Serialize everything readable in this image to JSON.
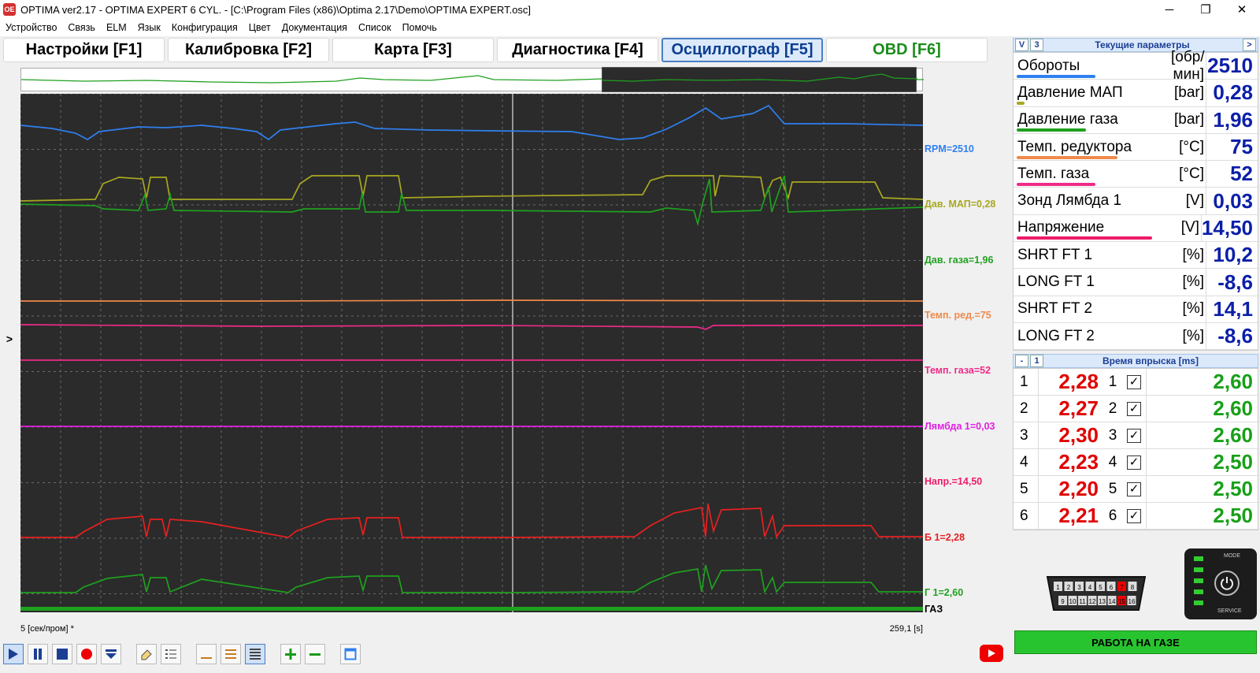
{
  "window": {
    "title": "OPTIMA ver2.17 - OPTIMA EXPERT 6 CYL. - [C:\\Program Files (x86)\\Optima 2.17\\Demo\\OPTIMA EXPERT.osc]",
    "icon_label": "OE",
    "minimize": "─",
    "maximize": "❐",
    "close": "✕"
  },
  "menu": [
    "Устройство",
    "Связь",
    "ELM",
    "Язык",
    "Конфигурация",
    "Цвет",
    "Документация",
    "Список",
    "Помочь"
  ],
  "tabs": [
    {
      "label": "Настройки [F1]",
      "active": false
    },
    {
      "label": "Калибровка [F2]",
      "active": false
    },
    {
      "label": "Карта [F3]",
      "active": false
    },
    {
      "label": "Диагностика [F4]",
      "active": false
    },
    {
      "label": "Осциллограф [F5]",
      "active": true
    },
    {
      "label": "OBD [F6]",
      "active": false
    }
  ],
  "side_toggle": ">",
  "scope": {
    "cursor_fraction": 0.545,
    "labels": [
      {
        "text": "RPM=2510",
        "color": "#2f80f0"
      },
      {
        "text": "Дав. МАП=0,28",
        "color": "#a8a822"
      },
      {
        "text": "Дав. газа=1,96",
        "color": "#1fa01f"
      },
      {
        "text": "Темп. ред.=75",
        "color": "#f08a4a"
      },
      {
        "text": "Темп. газа=52",
        "color": "#ee2b88"
      },
      {
        "text": "Лямбда 1=0,03",
        "color": "#e020e0"
      },
      {
        "text": "Напр.=14,50",
        "color": "#ee1c6a"
      },
      {
        "text": "Б 1=2,28",
        "color": "#e82020"
      },
      {
        "text": "Г 1=2,60",
        "color": "#1fa01f"
      },
      {
        "text": "ГАЗ",
        "color": "#000000"
      }
    ],
    "time_scale": "5 [сек/пром] *",
    "time_pos": "259,1 [s]"
  },
  "toolbar": [
    "play-icon",
    "pause-icon",
    "stop-icon",
    "record-icon",
    "download-icon",
    "eraser-icon",
    "list-icon",
    "single-line-icon",
    "multi-line-icon",
    "grid-line-icon",
    "zoom-in-icon",
    "zoom-out-icon",
    "window-icon"
  ],
  "params_panel": {
    "btn_v": "V",
    "btn_3": "3",
    "title": "Текущие параметры",
    "btn_next": ">",
    "rows": [
      {
        "name": "Обороты",
        "unit": "[обр/мин]",
        "value": "2510",
        "underline": "#2f80f0",
        "uw": 100
      },
      {
        "name": "Давление МАП",
        "unit": "[bar]",
        "value": "0,28",
        "underline": "#a8a822",
        "uw": 10
      },
      {
        "name": "Давление газа",
        "unit": "[bar]",
        "value": "1,96",
        "underline": "#1fa01f",
        "uw": 88
      },
      {
        "name": "Темп. редуктора",
        "unit": "[°C]",
        "value": "75",
        "underline": "#f08a4a",
        "uw": 128
      },
      {
        "name": "Темп. газа",
        "unit": "[°C]",
        "value": "52",
        "underline": "#ee2b88",
        "uw": 100
      },
      {
        "name": "Зонд Лямбда 1",
        "unit": "[V]",
        "value": "0,03",
        "underline": "",
        "uw": 0
      },
      {
        "name": "Напряжение",
        "unit": "[V]",
        "value": "14,50",
        "underline": "#ee1c6a",
        "uw": 172
      },
      {
        "name": "SHRT FT 1",
        "unit": "[%]",
        "value": "10,2",
        "underline": "",
        "uw": 0
      },
      {
        "name": "LONG FT 1",
        "unit": "[%]",
        "value": "-8,6",
        "underline": "",
        "uw": 0
      },
      {
        "name": "SHRT FT 2",
        "unit": "[%]",
        "value": "14,1",
        "underline": "",
        "uw": 0
      },
      {
        "name": "LONG FT 2",
        "unit": "[%]",
        "value": "-8,6",
        "underline": "",
        "uw": 0
      }
    ]
  },
  "inj_panel": {
    "btn_minus": "-",
    "btn_1": "1",
    "title": "Время впрыска [ms]",
    "rows": [
      {
        "cyl": "1",
        "petrol": "2,28",
        "gas_cyl": "1",
        "checked": "✓",
        "gas": "2,60"
      },
      {
        "cyl": "2",
        "petrol": "2,27",
        "gas_cyl": "2",
        "checked": "✓",
        "gas": "2,60"
      },
      {
        "cyl": "3",
        "petrol": "2,30",
        "gas_cyl": "3",
        "checked": "✓",
        "gas": "2,60"
      },
      {
        "cyl": "4",
        "petrol": "2,23",
        "gas_cyl": "4",
        "checked": "✓",
        "gas": "2,50"
      },
      {
        "cyl": "5",
        "petrol": "2,20",
        "gas_cyl": "5",
        "checked": "✓",
        "gas": "2,50"
      },
      {
        "cyl": "6",
        "petrol": "2,21",
        "gas_cyl": "6",
        "checked": "✓",
        "gas": "2,50"
      }
    ]
  },
  "device": {
    "mode": "MODE",
    "service": "SERVICE"
  },
  "obd_pins_top": [
    "1",
    "2",
    "3",
    "4",
    "5",
    "6",
    "7",
    "8"
  ],
  "obd_pins_bottom": [
    "9",
    "10",
    "11",
    "12",
    "13",
    "14",
    "15",
    "16"
  ],
  "status_button": "РАБОТА НА ГАЗЕ"
}
